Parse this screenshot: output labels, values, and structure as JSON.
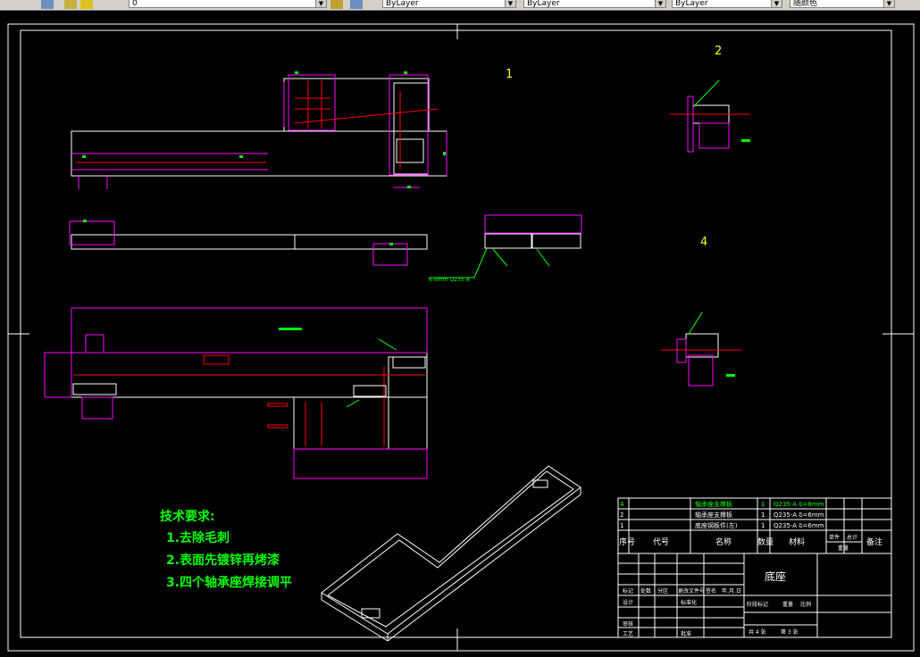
{
  "toolbar": {
    "layer_value": "0",
    "color_value": "ByLayer",
    "linetype_value": "ByLayer",
    "lineweight_value": "ByLayer",
    "plotstyle_value": "随颜色"
  },
  "drawing": {
    "view_labels": [
      "1",
      "2",
      "4"
    ],
    "weld_callout": "6-6mm Q235-A",
    "tech_title": "技术要求:",
    "tech_items": [
      "1.去除毛刺",
      "2.表面先镀锌再烤漆",
      "3.四个轴承座焊接调平"
    ]
  },
  "bom": {
    "rows": [
      {
        "no": "4",
        "name": "轴承座支撑板",
        "qty": "1",
        "material": "Q235-A δ=8mm"
      },
      {
        "no": "2",
        "name": "轴承座支撑板",
        "qty": "1",
        "material": "Q235-A δ=6mm"
      },
      {
        "no": "1",
        "name": "底座钢板件(左)",
        "qty": "1",
        "material": "Q235-A δ=6mm"
      }
    ],
    "headers": {
      "no": "序号",
      "code": "代号",
      "name": "名称",
      "qty": "数量",
      "material": "材料",
      "unit": "单件",
      "total": "总计",
      "weight": "重量",
      "remark": "备注"
    }
  },
  "title_block": {
    "part_name": "底座",
    "labels": [
      "标记",
      "处数",
      "分区",
      "更改文件号",
      "签名",
      "年.月.日",
      "设计",
      "标准化",
      "审核",
      "工艺",
      "批准",
      "阶段标记",
      "重量",
      "比例"
    ],
    "sheet_total": "共 4 张",
    "sheet_no": "第 3 张"
  },
  "colors": {
    "white": "#ffffff",
    "magenta": "#ff00ff",
    "red": "#ff0000",
    "green": "#00ff00",
    "cyan": "#00ffff",
    "yellow": "#ffff00"
  }
}
